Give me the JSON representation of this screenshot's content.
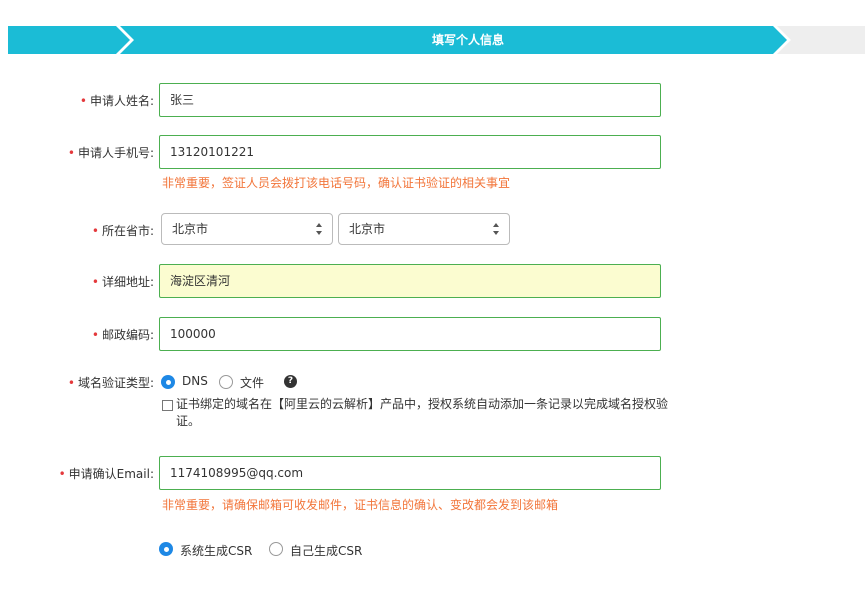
{
  "progress": {
    "current_step": "填写个人信息"
  },
  "form": {
    "name": {
      "label": "申请人姓名:",
      "value": "张三"
    },
    "phone": {
      "label": "申请人手机号:",
      "value": "13120101221",
      "hint": "非常重要，签证人员会拨打该电话号码，确认证书验证的相关事宜"
    },
    "region": {
      "label": "所在省市:",
      "province": "北京市",
      "city": "北京市"
    },
    "address": {
      "label": "详细地址:",
      "value": "海淀区清河"
    },
    "postcode": {
      "label": "邮政编码:",
      "value": "100000"
    },
    "verify": {
      "label": "域名验证类型:",
      "option_dns": "DNS",
      "option_file": "文件",
      "help": "?",
      "checkbox_text": "证书绑定的域名在【阿里云的云解析】产品中，授权系统自动添加一条记录以完成域名授权验证。"
    },
    "email": {
      "label": "申请确认Email:",
      "value": "1174108995@qq.com",
      "hint": "非常重要，请确保邮箱可收发邮件，证书信息的确认、变改都会发到该邮箱"
    },
    "csr": {
      "option_system": "系统生成CSR",
      "option_self": "自己生成CSR"
    }
  },
  "required_mark": "•",
  "colors": {
    "accent": "#1bbcd6",
    "border_valid": "#4caf50",
    "hint": "#f2753a",
    "required": "#e4393c",
    "radio_on": "#1e88e5"
  }
}
